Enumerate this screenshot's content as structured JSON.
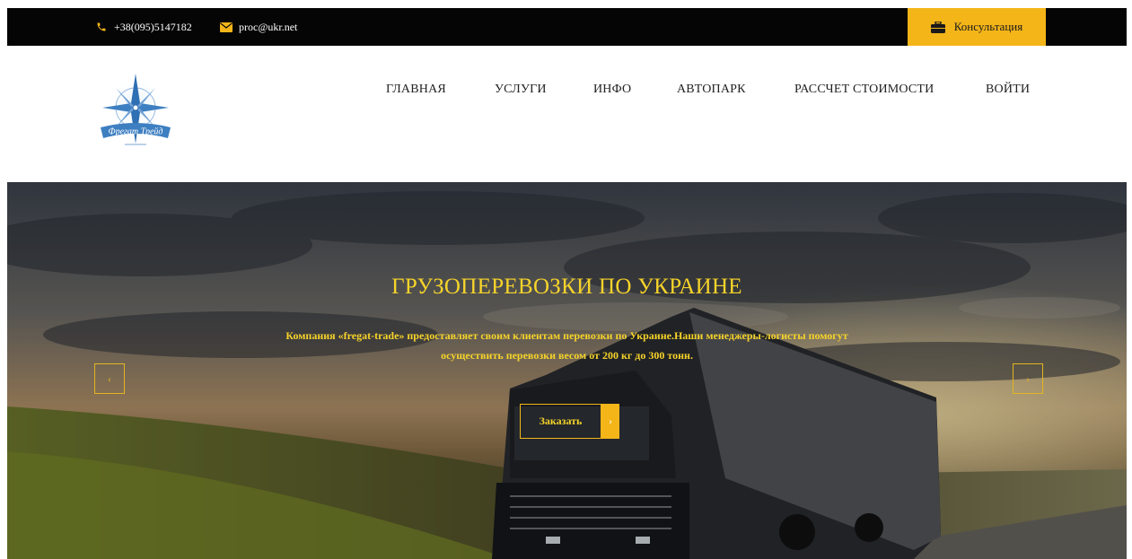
{
  "topbar": {
    "phone": "+38(095)5147182",
    "email": "proc@ukr.net",
    "consult_label": "Консультация",
    "phone_icon": "phone-icon",
    "email_icon": "envelope-icon",
    "consult_icon": "briefcase-icon"
  },
  "logo": {
    "text": "Фрегат Трейд"
  },
  "nav": {
    "items": [
      {
        "label": "ГЛАВНАЯ"
      },
      {
        "label": "УСЛУГИ"
      },
      {
        "label": "ИНФО"
      },
      {
        "label": "АВТОПАРК"
      },
      {
        "label": "РАССЧЕТ СТОИМОСТИ"
      },
      {
        "label": "ВОЙТИ"
      }
    ]
  },
  "hero": {
    "title": "ГРУЗОПЕРЕВОЗКИ ПО УКРАИНЕ",
    "description": "Компания «fregat-trade» предоставляет своим клиентам перевозки по Украине.Наши менеджеры-логисты помогут осуществить перевозки весом от 200 кг до 300 тонн.",
    "order_label": "Заказать",
    "prev_symbol": "‹",
    "next_symbol": "›",
    "order_chevron": "›"
  },
  "colors": {
    "accent": "#f4b519",
    "hero_text": "#f7d42a",
    "topbar_bg": "#050505",
    "logo_blue": "#3d7fc1"
  }
}
